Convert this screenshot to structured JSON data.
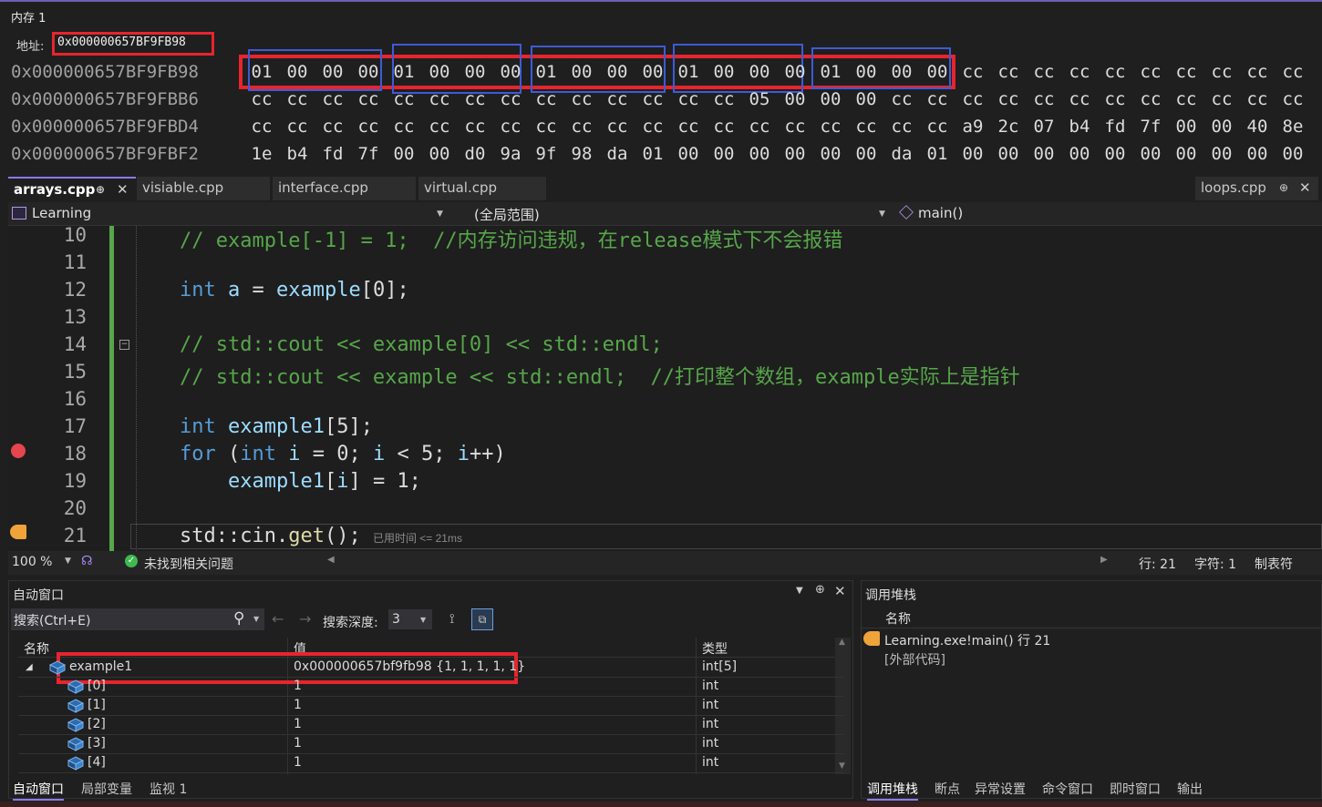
{
  "memory": {
    "title": "内存 1",
    "address_label": "地址:",
    "address_value": "0x000000657BF9FB98",
    "rows": [
      {
        "addr": "0x000000657BF9FB98",
        "bytes": [
          "01",
          "00",
          "00",
          "00",
          "01",
          "00",
          "00",
          "00",
          "01",
          "00",
          "00",
          "00",
          "01",
          "00",
          "00",
          "00",
          "01",
          "00",
          "00",
          "00",
          "cc",
          "cc",
          "cc",
          "cc",
          "cc",
          "cc",
          "cc",
          "cc",
          "cc",
          "cc"
        ]
      },
      {
        "addr": "0x000000657BF9FBB6",
        "bytes": [
          "cc",
          "cc",
          "cc",
          "cc",
          "cc",
          "cc",
          "cc",
          "cc",
          "cc",
          "cc",
          "cc",
          "cc",
          "cc",
          "cc",
          "05",
          "00",
          "00",
          "00",
          "cc",
          "cc",
          "cc",
          "cc",
          "cc",
          "cc",
          "cc",
          "cc",
          "cc",
          "cc",
          "cc",
          "cc"
        ]
      },
      {
        "addr": "0x000000657BF9FBD4",
        "bytes": [
          "cc",
          "cc",
          "cc",
          "cc",
          "cc",
          "cc",
          "cc",
          "cc",
          "cc",
          "cc",
          "cc",
          "cc",
          "cc",
          "cc",
          "cc",
          "cc",
          "cc",
          "cc",
          "cc",
          "cc",
          "a9",
          "2c",
          "07",
          "b4",
          "fd",
          "7f",
          "00",
          "00",
          "40",
          "8e"
        ]
      },
      {
        "addr": "0x000000657BF9FBF2",
        "bytes": [
          "1e",
          "b4",
          "fd",
          "7f",
          "00",
          "00",
          "d0",
          "9a",
          "9f",
          "98",
          "da",
          "01",
          "00",
          "00",
          "00",
          "00",
          "00",
          "00",
          "da",
          "01",
          "00",
          "00",
          "00",
          "00",
          "00",
          "00",
          "00",
          "00",
          "00",
          "00"
        ]
      }
    ]
  },
  "tabs": {
    "left": [
      "arrays.cpp",
      "visiable.cpp",
      "interface.cpp",
      "virtual.cpp"
    ],
    "right": "loops.cpp"
  },
  "navbar": {
    "project": "Learning",
    "scope": "(全局范围)",
    "member": "main()"
  },
  "editor": {
    "lines": [
      {
        "n": "10",
        "html": "<span class='cm'>// example[-1] = 1;  //内存访问违规，在release模式下不会报错</span>"
      },
      {
        "n": "11",
        "html": ""
      },
      {
        "n": "12",
        "html": "<span class='kw'>int</span> <span class='id'>a</span> = <span class='id'>example</span>[0];"
      },
      {
        "n": "13",
        "html": ""
      },
      {
        "n": "14",
        "html": "<span class='cm'>// std::cout &lt;&lt; example[0] &lt;&lt; std::endl;</span>"
      },
      {
        "n": "15",
        "html": "<span class='cm'>// std::cout &lt;&lt; example &lt;&lt; std::endl;  //打印整个数组，example实际上是指针</span>"
      },
      {
        "n": "16",
        "html": ""
      },
      {
        "n": "17",
        "html": "<span class='kw'>int</span> <span class='id'>example1</span>[5];"
      },
      {
        "n": "18",
        "html": "<span class='kw'>for</span> (<span class='kw'>int</span> <span class='id'>i</span> = 0; <span class='id'>i</span> &lt; 5; <span class='id'>i</span>++)"
      },
      {
        "n": "19",
        "html": "    <span class='id'>example1</span>[<span class='id'>i</span>] = 1;"
      },
      {
        "n": "20",
        "html": ""
      },
      {
        "n": "21",
        "html": "std::cin.<span class='fn'>get</span>(); <span style='font-size:12px;color:#8a8a8a;font-family:Liberation Sans,sans-serif'>已用时间 &lt;= 21ms</span>"
      }
    ]
  },
  "status": {
    "zoom": "100 %",
    "issues": "未找到相关问题",
    "line": "行: 21",
    "char": "字符: 1",
    "tab_mode": "制表符"
  },
  "autos": {
    "title": "自动窗口",
    "search_placeholder": "搜索(Ctrl+E)",
    "depth_label": "搜索深度:",
    "depth_value": "3",
    "columns": [
      "名称",
      "值",
      "类型"
    ],
    "rows": [
      {
        "name": "example1",
        "value": "0x000000657bf9fb98 {1, 1, 1, 1, 1}",
        "type": "int[5]"
      },
      {
        "name": "[0]",
        "value": "1",
        "type": "int"
      },
      {
        "name": "[1]",
        "value": "1",
        "type": "int"
      },
      {
        "name": "[2]",
        "value": "1",
        "type": "int"
      },
      {
        "name": "[3]",
        "value": "1",
        "type": "int"
      },
      {
        "name": "[4]",
        "value": "1",
        "type": "int"
      }
    ],
    "bottom_tabs": [
      "自动窗口",
      "局部变量",
      "监视 1"
    ]
  },
  "callstack": {
    "title": "调用堆栈",
    "column": "名称",
    "rows": [
      "Learning.exe!main() 行 21",
      "[外部代码]"
    ],
    "bottom_tabs": [
      "调用堆栈",
      "断点",
      "异常设置",
      "命令窗口",
      "即时窗口",
      "输出"
    ]
  },
  "colors": {
    "highlight_red": "#e6252e",
    "highlight_blue": "#3d5bd6",
    "keyword": "#569cd6",
    "comment": "#57a64a"
  }
}
